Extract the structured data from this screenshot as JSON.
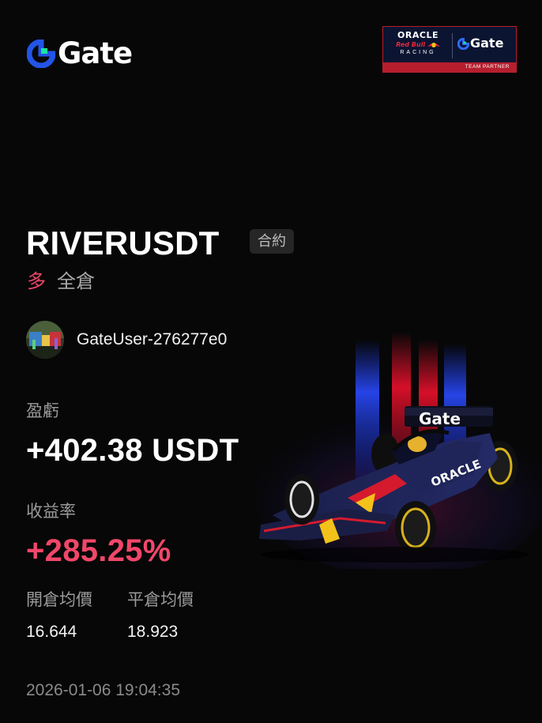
{
  "header": {
    "brand_name": "Gate",
    "partner": {
      "oracle": "ORACLE",
      "red_bull": "Red Bull",
      "racing": "RACING",
      "gate": "Gate",
      "strip": "TEAM PARTNER"
    }
  },
  "position": {
    "symbol": "RIVERUSDT",
    "type_badge": "合約",
    "direction": "多",
    "margin_mode": "全倉"
  },
  "user": {
    "name": "GateUser-276277e0"
  },
  "pnl": {
    "label": "盈虧",
    "value": "+402.38 USDT"
  },
  "roi": {
    "label": "收益率",
    "value": "+285.25%"
  },
  "prices": {
    "open_label": "開倉均價",
    "close_label": "平倉均價",
    "open_value": "16.644",
    "close_value": "18.923"
  },
  "timestamp": "2026-01-06 19:04:35",
  "car_livery_text": "Gate",
  "car_sponsor_text": "ORACLE",
  "colors": {
    "background": "#070707",
    "long": "#f0476a",
    "gate_blue": "#2354e6",
    "gate_green": "#17e6a1"
  }
}
